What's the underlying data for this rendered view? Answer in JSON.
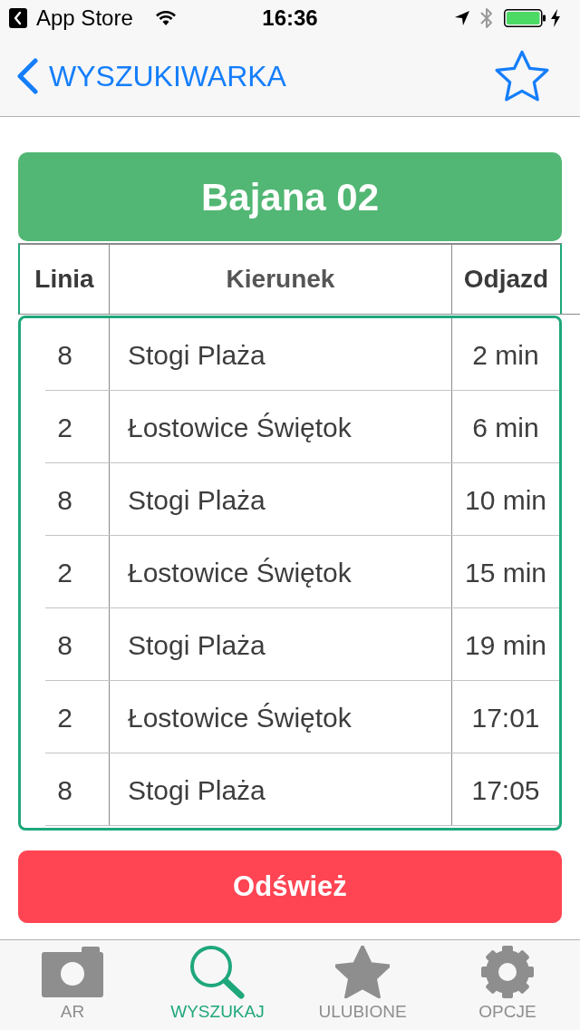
{
  "status_bar": {
    "back_label": "App Store",
    "time": "16:36"
  },
  "nav_bar": {
    "back_label": "WYSZUKIWARKA",
    "starred": false
  },
  "stop": {
    "title": "Bajana 02"
  },
  "table": {
    "columns": [
      "Linia",
      "Kierunek",
      "Odjazd"
    ],
    "rows": [
      {
        "line": "8",
        "direction": "Stogi Plaża",
        "departure": "2 min"
      },
      {
        "line": "2",
        "direction": "Łostowice Świętok",
        "departure": "6 min"
      },
      {
        "line": "8",
        "direction": "Stogi Plaża",
        "departure": "10 min"
      },
      {
        "line": "2",
        "direction": "Łostowice Świętok",
        "departure": "15 min"
      },
      {
        "line": "8",
        "direction": "Stogi Plaża",
        "departure": "19 min"
      },
      {
        "line": "2",
        "direction": "Łostowice Świętok",
        "departure": "17:01"
      },
      {
        "line": "8",
        "direction": "Stogi Plaża",
        "departure": "17:05"
      }
    ]
  },
  "refresh_button": {
    "label": "Odśwież"
  },
  "tab_bar": [
    {
      "label": "AR",
      "selected": false
    },
    {
      "label": "WYSZUKAJ",
      "selected": true
    },
    {
      "label": "ULUBIONE",
      "selected": false
    },
    {
      "label": "OPCJE",
      "selected": false
    }
  ]
}
